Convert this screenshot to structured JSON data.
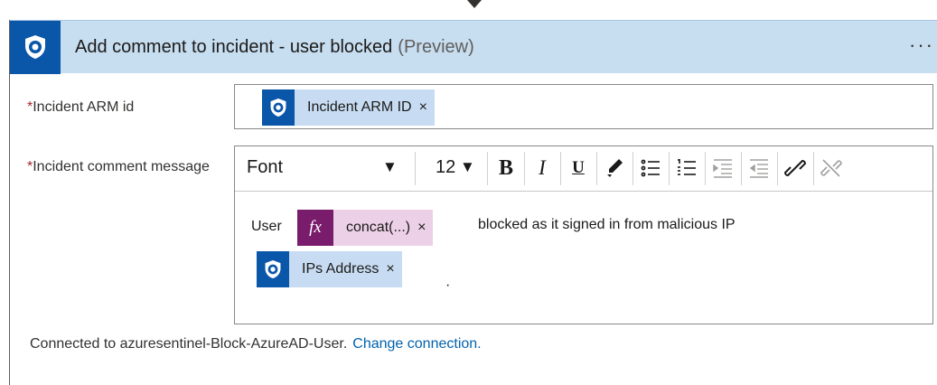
{
  "header": {
    "title": "Add comment to incident - user blocked",
    "preview": "(Preview)",
    "more": "···",
    "icon": "sentinel-shield-icon",
    "brand_color": "#0a56a8",
    "header_bg": "#c7ddf0"
  },
  "fields": {
    "arm": {
      "required_mark": "*",
      "label": "Incident ARM id",
      "token_label": "Incident ARM ID",
      "token_remove": "×"
    },
    "comment": {
      "required_mark": "*",
      "label": "Incident comment message",
      "toolbar": {
        "font": "Font",
        "size": "12",
        "caret": "▼",
        "bold": "B",
        "italic": "I",
        "underline": "U"
      },
      "content": {
        "prefix": "User",
        "concat_token": "concat(...)",
        "concat_remove": "×",
        "suffix": "blocked as it signed in from malicious IP",
        "ip_token": "IPs Address",
        "ip_remove": "×",
        "trailing": "·"
      }
    }
  },
  "footer": {
    "connected_text": "Connected to azuresentinel-Block-AzureAD-User.",
    "change_link": "Change connection."
  }
}
